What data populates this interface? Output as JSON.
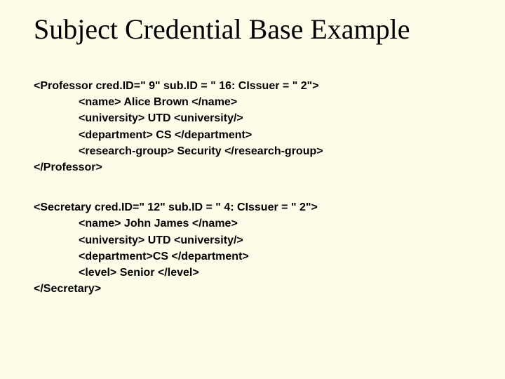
{
  "title": "Subject Credential Base Example",
  "block1": {
    "l1": "<Professor cred.ID=\" 9\" sub.ID = \" 16: CIssuer = \" 2\">",
    "l2": "<name> Alice Brown </name>",
    "l3": "<university> UTD <university/>",
    "l4": "<department> CS </department>",
    "l5": "<research-group> Security </research-group>",
    "l6": "</Professor>"
  },
  "block2": {
    "l1": "<Secretary cred.ID=\" 12\" sub.ID = \" 4: CIssuer = \" 2\">",
    "l2": "<name> John James </name>",
    "l3": "<university> UTD <university/>",
    "l4": "<department>CS </department>",
    "l5": "<level> Senior </level>",
    "l6": "</Secretary>"
  }
}
